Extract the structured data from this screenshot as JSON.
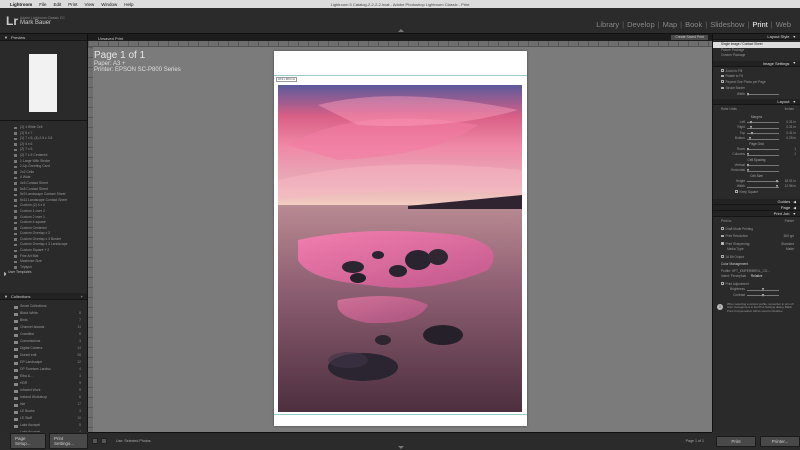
{
  "mac_menu": {
    "items": [
      "Lightroom",
      "File",
      "Edit",
      "Print",
      "View",
      "Window",
      "Help"
    ],
    "window_title": "Lightroom 5 Catalog-2-2-2-2.lrcat - Adobe Photoshop Lightroom Classic - Print",
    "clock": "Mon 13:34",
    "user": "Mark Bauer"
  },
  "identity": {
    "logo": "Lr",
    "small_text": "Adobe Lightroom Classic CC",
    "name": "Mark Bauer"
  },
  "modules": [
    {
      "label": "Library",
      "active": false
    },
    {
      "label": "Develop",
      "active": false
    },
    {
      "label": "Map",
      "active": false
    },
    {
      "label": "Book",
      "active": false
    },
    {
      "label": "Slideshow",
      "active": false
    },
    {
      "label": "Print",
      "active": true
    },
    {
      "label": "Web",
      "active": false
    }
  ],
  "left_panel": {
    "preview_label": "Preview",
    "template_items": [
      "(1) 4 Wide Cell",
      "(1) 5 x 7",
      "(1) 7 x 5, (4) 2.5 x 3.5",
      "(2) 4 x 6",
      "(2) 7 x 5",
      "(2) 7 x 5 Centered",
      "1 Large With Stroke",
      "2-Up Greeting Card",
      "2x2 Cells",
      "4 Wide",
      "4x5 Contact Sheet",
      "5x8 Contact Sheet",
      "5x9 Landscape Contact Sheet",
      "5x11 Landscape Contact Sheet",
      "Custom (2) 4 x 6",
      "Custom 1 over 2",
      "Custom 2 over 1",
      "Custom 4 square",
      "Custom Centered",
      "Custom Overlap x 3",
      "Custom Overlap x 3 Border",
      "Custom Overlap x 3 Landscape",
      "Custom Square + 2",
      "Fine Art Mat",
      "Maximize Size",
      "Triptych"
    ],
    "user_templates_label": "User Templates",
    "collections_label": "Collections",
    "collections": [
      {
        "name": "Smart Collections",
        "count": ""
      },
      {
        "name": "Black White",
        "count": "8"
      },
      {
        "name": "Birds",
        "count": "7"
      },
      {
        "name": "Channel Islands",
        "count": "11"
      },
      {
        "name": "Coastline",
        "count": "6"
      },
      {
        "name": "Commissions",
        "count": "3"
      },
      {
        "name": "Digital Camera",
        "count": "14"
      },
      {
        "name": "Dorset edit",
        "count": "28"
      },
      {
        "name": "DP Landscape",
        "count": "12"
      },
      {
        "name": "DP Sunrises Landsc",
        "count": "4"
      },
      {
        "name": "Elba &...",
        "count": "3"
      },
      {
        "name": "HDR",
        "count": "9"
      },
      {
        "name": "Infrared Work",
        "count": "5"
      },
      {
        "name": "Iceland Workshop",
        "count": "6"
      },
      {
        "name": "Isle",
        "count": "17"
      },
      {
        "name": "LE Books",
        "count": "3"
      },
      {
        "name": "LE Stuff",
        "count": "10"
      },
      {
        "name": "Lake Ascapel",
        "count": "5"
      },
      {
        "name": "Lake Ascapel",
        "count": "4"
      },
      {
        "name": "Large Exposures",
        "count": "3"
      },
      {
        "name": "Long Exposures",
        "count": "7"
      },
      {
        "name": "LPOTY",
        "count": "2"
      },
      {
        "name": "My Pictures",
        "count": "4152"
      }
    ],
    "page_setup_label": "Page Setup...",
    "print_settings_label": "Print Settings..."
  },
  "center": {
    "unsaved_label": "Unsaved Print",
    "create_saved_label": "Create Saved Print",
    "page_title": "Page 1 of 1",
    "paper": "Paper:  A3 +",
    "printer": "Printer:  EPSON SC-P800 Series",
    "cell_dimensions": "32.9 x 48.0 cm",
    "toolbar_use": "Use:",
    "toolbar_selected": "Selected Photos",
    "page_count": "Page 1 of 1"
  },
  "right_panel": {
    "layout_style_label": "Layout Style",
    "layout_styles": [
      "Single Image / Contact Sheet",
      "Picture Package",
      "Custom Package"
    ],
    "image_settings_label": "Image Settings",
    "image_settings": [
      "Zoom to Fill",
      "Rotate to Fit",
      "Repeat One Photo per Page"
    ],
    "stroke_border_label": "Stroke Border",
    "width_label": "Width",
    "layout_label": "Layout",
    "ruler_units_label": "Ruler Units",
    "ruler_units_value": "Inches",
    "margins_label": "Margins",
    "margins": [
      {
        "label": "Left",
        "value": "0.31 in",
        "pos": 0.1
      },
      {
        "label": "Right",
        "value": "0.31 in",
        "pos": 0.1
      },
      {
        "label": "Top",
        "value": "0.41 in",
        "pos": 0.12
      },
      {
        "label": "Bottom",
        "value": "0.25 in",
        "pos": 0.08
      }
    ],
    "page_grid_label": "Page Grid",
    "grid": [
      {
        "label": "Rows",
        "value": "1",
        "pos": 0.0
      },
      {
        "label": "Columns",
        "value": "1",
        "pos": 0.0
      }
    ],
    "cell_spacing_label": "Cell Spacing",
    "spacing": [
      {
        "label": "Vertical",
        "value": "",
        "pos": 0.0
      },
      {
        "label": "Horizontal",
        "value": "",
        "pos": 0.0
      }
    ],
    "cell_size_label": "Cell Size",
    "cell_size": [
      {
        "label": "Height",
        "value": "18.91 in",
        "pos": 0.95
      },
      {
        "label": "Width",
        "value": "12.96 in",
        "pos": 0.95
      }
    ],
    "keep_square_label": "Keep Square",
    "guides_label": "Guides",
    "page_label": "Page",
    "print_job_label": "Print Job",
    "print_to_label": "Print to:",
    "print_to_value": "Printer",
    "draft_mode_label": "Draft Mode Printing",
    "print_resolution_label": "Print Resolution",
    "print_resolution_value": "360 ppi",
    "print_sharpening_label": "Print Sharpening:",
    "print_sharpening_value": "Standard",
    "media_type_label": "Media Type:",
    "media_type_value": "Matte",
    "bit_output_label": "16 Bit Output",
    "color_management_label": "Color Management",
    "profile_label": "Profile:",
    "profile_value": "HFT_EMPERIBRGL_CO...",
    "intent_label": "Intent:",
    "intent_options": [
      "Perceptual",
      "Relative"
    ],
    "print_adjustment_label": "Print Adjustment",
    "brightness_label": "Brightness",
    "contrast_label": "Contrast",
    "warning_text": "When selecting a custom profile, remember to turn off color management in the Print Settings dialog. Black Point Compensation will be used for Relative",
    "print_button": "Print",
    "printer_button": "Printer..."
  },
  "colors": {
    "panel_bg": "#2a2a2a",
    "canvas_bg": "#7b7b7b",
    "active_module": "#ffffff"
  }
}
